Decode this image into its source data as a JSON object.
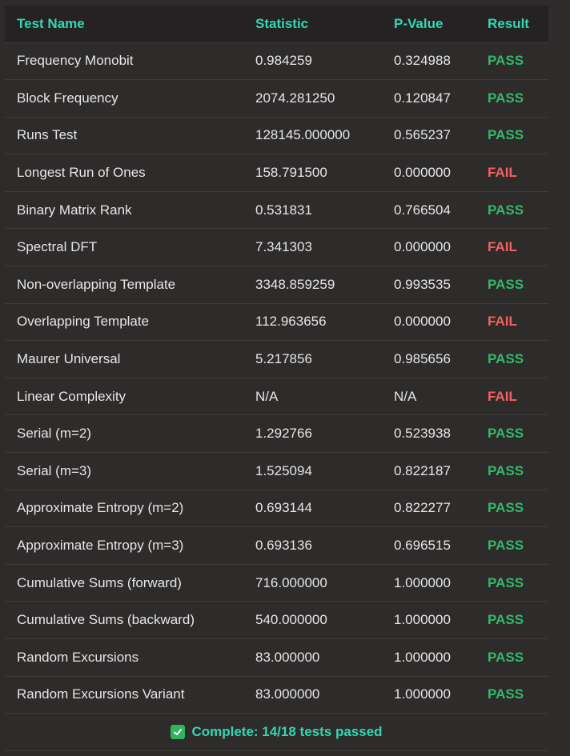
{
  "colors": {
    "background": "#2e2b2b",
    "header_background": "#242222",
    "header_text": "#35d6b2",
    "pass": "#33b86a",
    "fail": "#f06262",
    "summary_text": "#35d6b2"
  },
  "table": {
    "headers": {
      "test_name": "Test Name",
      "statistic": "Statistic",
      "p_value": "P-Value",
      "result": "Result"
    },
    "rows": [
      {
        "name": "Frequency Monobit",
        "statistic": "0.984259",
        "p_value": "0.324988",
        "result": "PASS"
      },
      {
        "name": "Block Frequency",
        "statistic": "2074.281250",
        "p_value": "0.120847",
        "result": "PASS"
      },
      {
        "name": "Runs Test",
        "statistic": "128145.000000",
        "p_value": "0.565237",
        "result": "PASS"
      },
      {
        "name": "Longest Run of Ones",
        "statistic": "158.791500",
        "p_value": "0.000000",
        "result": "FAIL"
      },
      {
        "name": "Binary Matrix Rank",
        "statistic": "0.531831",
        "p_value": "0.766504",
        "result": "PASS"
      },
      {
        "name": "Spectral DFT",
        "statistic": "7.341303",
        "p_value": "0.000000",
        "result": "FAIL"
      },
      {
        "name": "Non-overlapping Template",
        "statistic": "3348.859259",
        "p_value": "0.993535",
        "result": "PASS"
      },
      {
        "name": "Overlapping Template",
        "statistic": "112.963656",
        "p_value": "0.000000",
        "result": "FAIL"
      },
      {
        "name": "Maurer Universal",
        "statistic": "5.217856",
        "p_value": "0.985656",
        "result": "PASS"
      },
      {
        "name": "Linear Complexity",
        "statistic": "N/A",
        "p_value": "N/A",
        "result": "FAIL"
      },
      {
        "name": "Serial (m=2)",
        "statistic": "1.292766",
        "p_value": "0.523938",
        "result": "PASS"
      },
      {
        "name": "Serial (m=3)",
        "statistic": "1.525094",
        "p_value": "0.822187",
        "result": "PASS"
      },
      {
        "name": "Approximate Entropy (m=2)",
        "statistic": "0.693144",
        "p_value": "0.822277",
        "result": "PASS"
      },
      {
        "name": "Approximate Entropy (m=3)",
        "statistic": "0.693136",
        "p_value": "0.696515",
        "result": "PASS"
      },
      {
        "name": "Cumulative Sums (forward)",
        "statistic": "716.000000",
        "p_value": "1.000000",
        "result": "PASS"
      },
      {
        "name": "Cumulative Sums (backward)",
        "statistic": "540.000000",
        "p_value": "1.000000",
        "result": "PASS"
      },
      {
        "name": "Random Excursions",
        "statistic": "83.000000",
        "p_value": "1.000000",
        "result": "PASS"
      },
      {
        "name": "Random Excursions Variant",
        "statistic": "83.000000",
        "p_value": "1.000000",
        "result": "PASS"
      }
    ]
  },
  "summary": {
    "icon": "check-box-icon",
    "text": "Complete: 14/18 tests passed"
  }
}
